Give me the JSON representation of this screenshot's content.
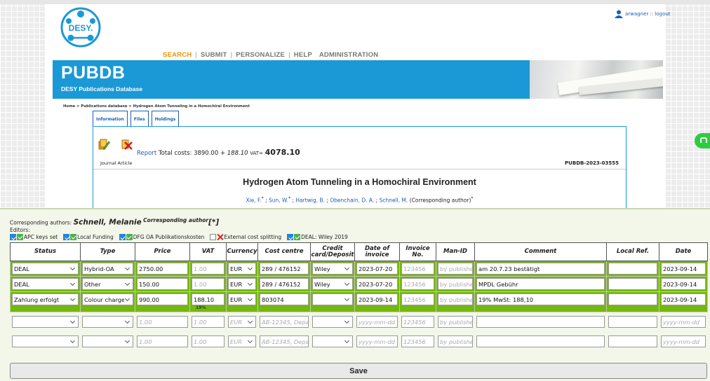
{
  "header": {
    "user": "arwagner :: logout",
    "logo_text": "DESY.",
    "nav": [
      "SEARCH",
      "SUBMIT",
      "PERSONALIZE",
      "HELP",
      "ADMINISTRATION"
    ],
    "brand": "PUBDB",
    "brand_sub": "DESY Publications Database"
  },
  "breadcrumb": "Home > Publications database > Hydrogen Atom Tunneling in a Homochiral Environment",
  "tabs": [
    "Information",
    "Files",
    "Holdings"
  ],
  "record": {
    "report_link": "Report",
    "costs_label": "Total costs:",
    "costs_base": "3890.00",
    "costs_plus": "+",
    "costs_vat": "188.10",
    "vat_label": "VAT=",
    "costs_total": "4078.10",
    "type": "Journal Article",
    "id": "PUBDB-2023-03555",
    "title": "Hydrogen Atom Tunneling in a Homochiral Environment",
    "authors": [
      {
        "name": "Xie, F.",
        "sep": " ; "
      },
      {
        "name": "Sun, W.",
        "sep": " ; "
      },
      {
        "name": "Hartwig, B.",
        "sep": " ; "
      },
      {
        "name": "Obenchain, D. A.",
        "sep": " ; "
      },
      {
        "name": "Schnell, M.",
        "sep": ""
      }
    ],
    "author_suffix": "(Corresponding author)"
  },
  "panel": {
    "corr_label": "Corresponding authors:",
    "corr_name": "Schnell, Melanie",
    "corr_sup": "Corresponding author",
    "corr_mark": "[*]",
    "editors_label": "Editors:",
    "flags": [
      {
        "label": "APC keys set",
        "state": "ok"
      },
      {
        "label": "Local Funding",
        "state": "ok"
      },
      {
        "label": "DFG OA Publikationskosten",
        "state": "ok"
      },
      {
        "label": "External cost splitting",
        "state": "x"
      },
      {
        "label": "DEAL: Wiley 2019",
        "state": "ok"
      }
    ],
    "columns": [
      "Status",
      "Type",
      "Price",
      "VAT",
      "Currency",
      "Cost centre",
      "Credit card/Deposit",
      "Date of invoice",
      "Invoice No.",
      "Man-ID",
      "Comment",
      "Local Ref.",
      "Date"
    ],
    "rows": [
      {
        "status": "DEAL",
        "type": "Hybrid-OA",
        "price": "2750.00",
        "vat": "1.00",
        "currency": "EUR",
        "cost_centre": "289 / 476152",
        "credit": "Wiley",
        "date_invoice": "2023-07-20",
        "invoice_no": "123456",
        "man_id": "by publishe",
        "comment": "am 20.7.23 bestätigt",
        "local_ref": "",
        "date": "2023-09-14",
        "note": ""
      },
      {
        "status": "DEAL",
        "type": "Other",
        "price": "150.00",
        "vat": "1.00",
        "currency": "EUR",
        "cost_centre": "289 / 476152",
        "credit": "Wiley",
        "date_invoice": "2023-07-20",
        "invoice_no": "123456",
        "man_id": "by publishe",
        "comment": "MPDL Gebühr",
        "local_ref": "",
        "date": "2023-09-14",
        "note": ""
      },
      {
        "status": "Zahlung erfolgt",
        "type": "Colour charge",
        "price": "990.00",
        "vat": "188.10",
        "currency": "EUR",
        "cost_centre": "803074",
        "credit": "",
        "date_invoice": "2023-09-14",
        "invoice_no": "123456",
        "man_id": "by publishe",
        "comment": "19% MwSt: 188,10",
        "local_ref": "",
        "date": "2023-09-14",
        "note": "19%"
      }
    ],
    "placeholders": {
      "price": "1.00",
      "vat": "1.00",
      "currency": "EUR",
      "cost_centre": "AB-12345, Depa",
      "date_invoice": "yyyy-mm-dd",
      "invoice_no": "123456",
      "man_id": "by publishe",
      "date": "yyyy-mm-dd"
    },
    "save_label": "Save"
  }
}
